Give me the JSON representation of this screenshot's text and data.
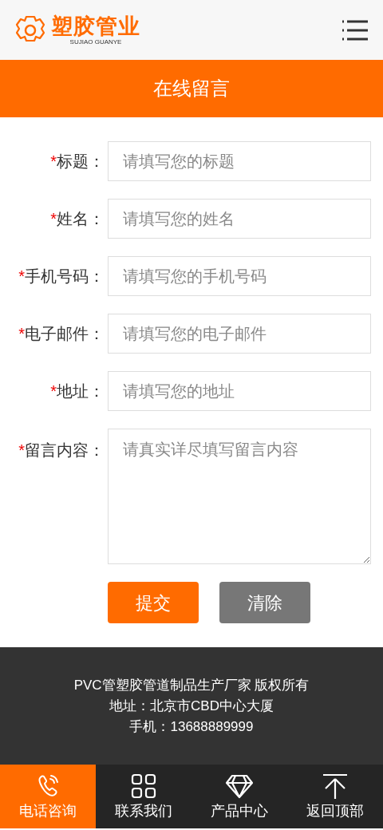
{
  "header": {
    "logo_title": "塑胶管业",
    "logo_subtitle": "SUJIAO GUANYE"
  },
  "page_title": "在线留言",
  "form": {
    "fields": [
      {
        "kind": "input",
        "required_mark": "*",
        "label": "标题：",
        "placeholder": "请填写您的标题"
      },
      {
        "kind": "input",
        "required_mark": "*",
        "label": "姓名：",
        "placeholder": "请填写您的姓名"
      },
      {
        "kind": "input",
        "required_mark": "*",
        "label": "手机号码：",
        "placeholder": "请填写您的手机号码"
      },
      {
        "kind": "input",
        "required_mark": "*",
        "label": "电子邮件：",
        "placeholder": "请填写您的电子邮件"
      },
      {
        "kind": "input",
        "required_mark": "*",
        "label": "地址：",
        "placeholder": "请填写您的地址"
      },
      {
        "kind": "textarea",
        "required_mark": "*",
        "label": "留言内容：",
        "placeholder": "请真实详尽填写留言内容"
      }
    ],
    "buttons": [
      {
        "kind": "submit",
        "label": "提交"
      },
      {
        "kind": "reset",
        "label": "清除"
      }
    ]
  },
  "footer": [
    "PVC管塑胶管道制品生产厂家 版权所有",
    "地址：北京市CBD中心大厦",
    "手机：13688889999"
  ],
  "bottom_nav": [
    {
      "kind": "phone",
      "label": "电话咨询",
      "selected": true
    },
    {
      "kind": "grid",
      "label": "联系我们",
      "selected": false
    },
    {
      "kind": "diamond",
      "label": "产品中心",
      "selected": false
    },
    {
      "kind": "top",
      "label": "返回顶部",
      "selected": false
    }
  ]
}
